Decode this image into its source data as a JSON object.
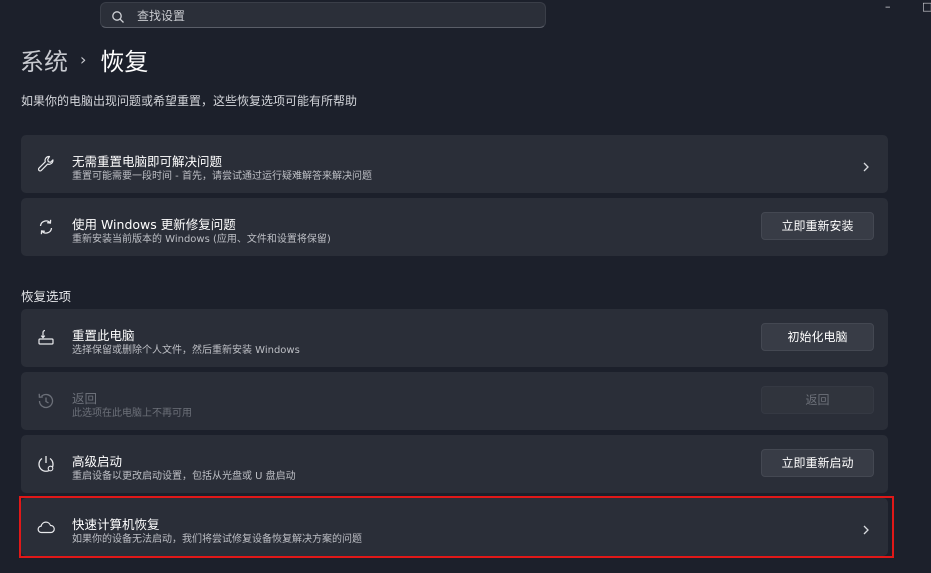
{
  "search": {
    "placeholder": "查找设置"
  },
  "window_controls": {
    "minimize": "–",
    "maximize": "□"
  },
  "breadcrumb": {
    "parent": "系统",
    "separator": "›",
    "current": "恢复"
  },
  "subtitle": "如果你的电脑出现问题或希望重置，这些恢复选项可能有所帮助",
  "cards_top": [
    {
      "icon": "wrench-icon",
      "title": "无需重置电脑即可解决问题",
      "desc": "重置可能需要一段时间 - 首先，请尝试通过运行疑难解答来解决问题",
      "action": "chevron"
    },
    {
      "icon": "sync-icon",
      "title": "使用 Windows 更新修复问题",
      "desc": "重新安装当前版本的 Windows (应用、文件和设置将保留)",
      "button": "立即重新安装"
    }
  ],
  "section_title": "恢复选项",
  "options": [
    {
      "icon": "reset-pc-icon",
      "title": "重置此电脑",
      "desc": "选择保留或删除个人文件，然后重新安装 Windows",
      "button": "初始化电脑",
      "disabled": false
    },
    {
      "icon": "history-icon",
      "title": "返回",
      "desc": "此选项在此电脑上不再可用",
      "button": "返回",
      "disabled": true
    },
    {
      "icon": "advanced-startup-icon",
      "title": "高级启动",
      "desc": "重启设备以更改启动设置，包括从光盘或 U 盘启动",
      "button": "立即重新启动",
      "disabled": false
    },
    {
      "icon": "cloud-icon",
      "title": "快速计算机恢复",
      "desc": "如果你的设备无法启动，我们将尝试修复设备恢复解决方案的问题",
      "action": "chevron",
      "highlighted": true
    }
  ],
  "colors": {
    "background": "#1c202b",
    "card": "#2a2e38",
    "highlight": "#e01818"
  }
}
